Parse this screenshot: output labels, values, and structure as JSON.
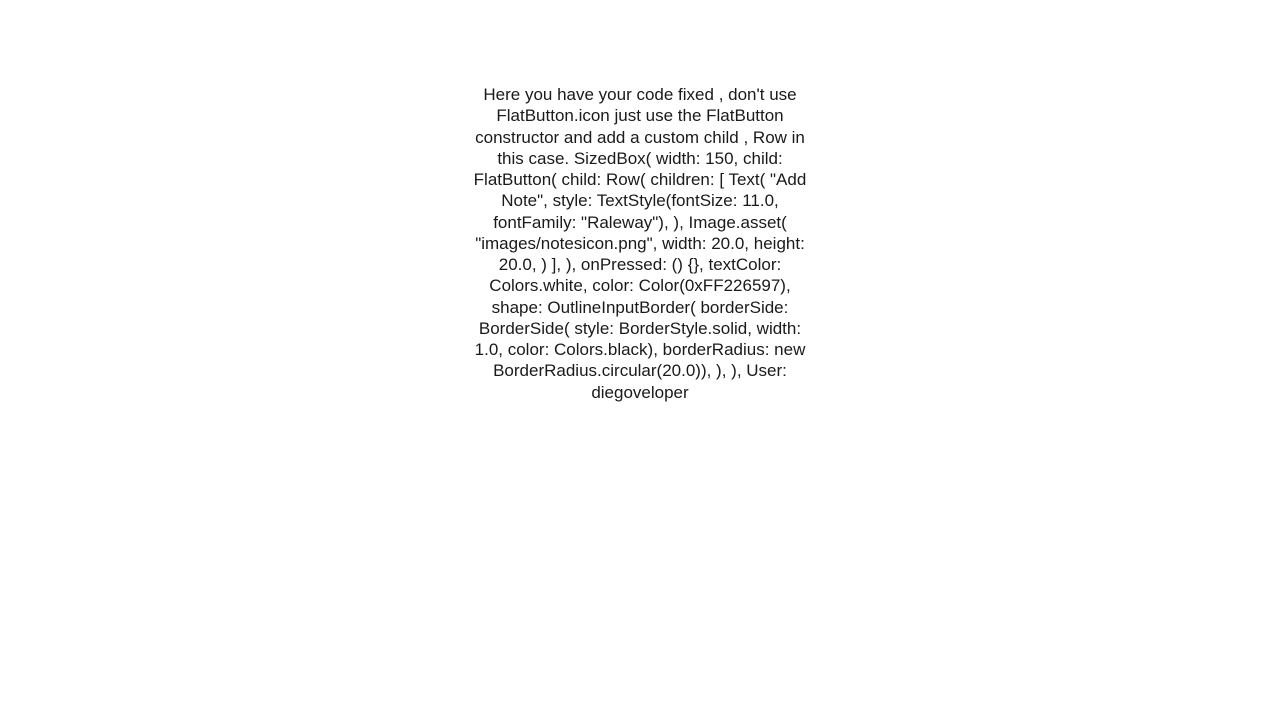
{
  "lines": [
    "Here you have your code fixed , don't use FlatButton.icon just use the FlatButton constructor and add a custom child , Row in this case.     SizedBox(             width: 150,             child: FlatButton(               child: Row(                 children: [                   Text(                     \"Add Note\",                     style: TextStyle(fontSize: 11.0, fontFamily: \"Raleway\"),                   ),                   Image.asset(                     \"images/notesicon.png\",                     width: 20.0,                     height: 20.0,                   )                 ],               ),               onPressed: () {},               textColor: Colors.white,               color: Color(0xFF226597),               shape: OutlineInputBorder(                   borderSide: BorderSide(                       style: BorderStyle.solid, width: 1.0, color: Colors.black),                   borderRadius: new BorderRadius.circular(20.0)),             ),           ),   User: diegoveloper"
  ]
}
